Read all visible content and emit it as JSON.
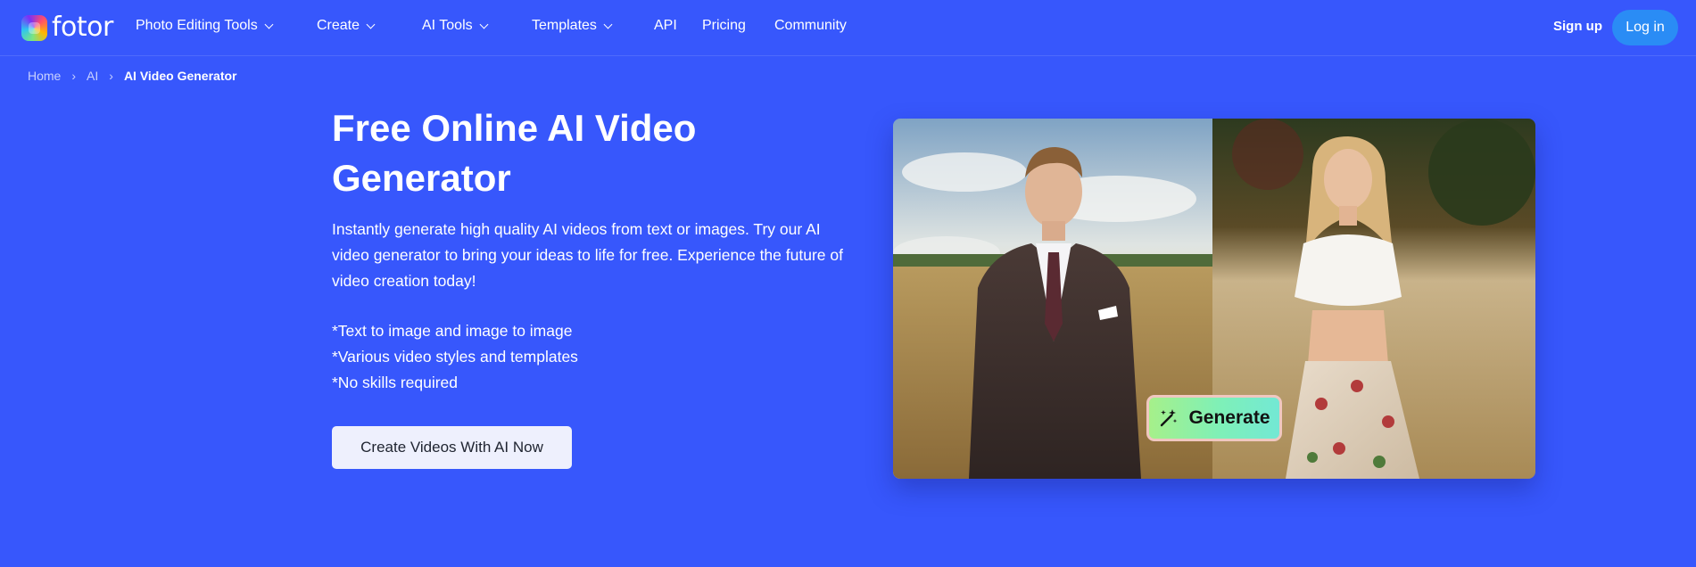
{
  "header": {
    "logo_text": "fotor",
    "nav": [
      {
        "label": "Photo Editing Tools",
        "dropdown": true
      },
      {
        "label": "Create",
        "dropdown": true
      },
      {
        "label": "AI Tools",
        "dropdown": true
      },
      {
        "label": "Templates",
        "dropdown": true
      },
      {
        "label": "API",
        "dropdown": false
      },
      {
        "label": "Pricing",
        "dropdown": false
      },
      {
        "label": "Community",
        "dropdown": false
      }
    ],
    "signup_label": "Sign up",
    "login_label": "Log in"
  },
  "breadcrumb": {
    "items": [
      "Home",
      "AI"
    ],
    "current": "AI Video Generator"
  },
  "hero": {
    "title": "Free Online AI Video Generator",
    "description": "Instantly generate high quality AI videos from text or images. Try our AI video generator to bring your ideas to life for free. Experience the future of video creation today!",
    "bullets": [
      "*Text to image and image to image",
      "*Various video styles and templates",
      "*No skills required"
    ],
    "cta_label": "Create Videos With AI Now"
  },
  "preview": {
    "generate_label": "Generate",
    "icon": "magic-wand-icon"
  },
  "colors": {
    "background": "#3757fc",
    "login_button": "#2a8cf5",
    "cta_button": "#eef0fd"
  }
}
